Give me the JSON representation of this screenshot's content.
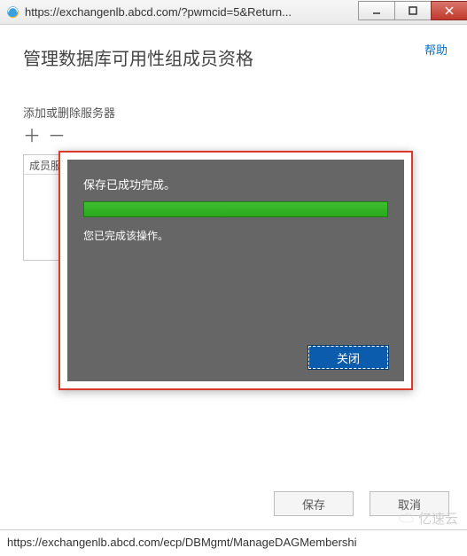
{
  "window": {
    "url_display": "https://exchangenlb.abcd.com/?pwmcid=5&Return...",
    "status_url": "https://exchangenlb.abcd.com/ecp/DBMgmt/ManageDAGMembershi"
  },
  "header": {
    "help_label": "帮助",
    "page_title": "管理数据库可用性组成员资格"
  },
  "section": {
    "label": "添加或删除服务器",
    "list_header": "成员服"
  },
  "modal": {
    "message1": "保存已成功完成。",
    "message2": "您已完成该操作。",
    "close_label": "关闭"
  },
  "footer": {
    "save_label": "保存",
    "cancel_label": "取消"
  },
  "watermark": "亿速云"
}
